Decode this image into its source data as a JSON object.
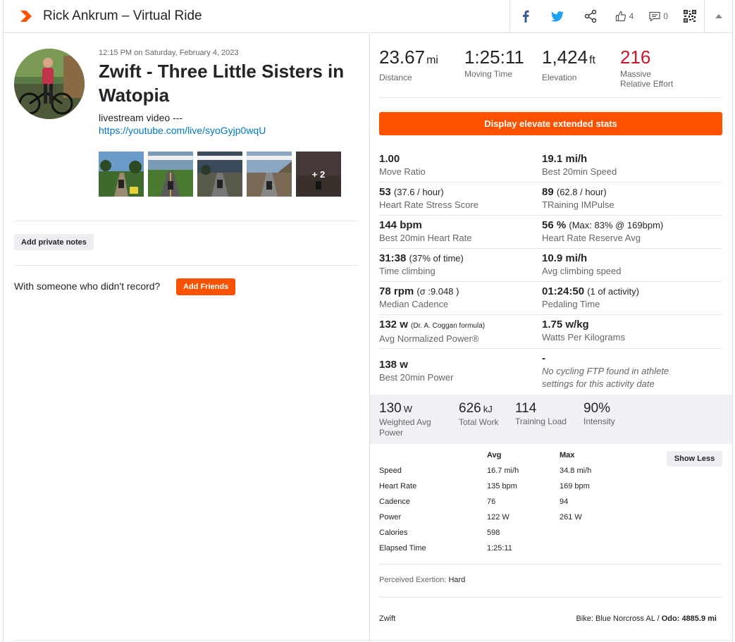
{
  "header": {
    "title": "Rick Ankrum – Virtual Ride",
    "kudos_count": "4",
    "comment_count": "0"
  },
  "activity": {
    "timestamp": "12:15 PM on Saturday, February 4, 2023",
    "title": "Zwift - Three Little Sisters in Watopia",
    "description": "livestream video ---",
    "link": "https://youtube.com/live/syoGyjp0wqU",
    "photos_more": "+ 2"
  },
  "left": {
    "private_notes_label": "Add private notes",
    "with_someone_text": "With someone who didn't record?",
    "add_friends_label": "Add Friends"
  },
  "summary": {
    "distance_value": "23.67",
    "distance_unit": "mi",
    "distance_label": "Distance",
    "moving_time_value": "1:25:11",
    "moving_time_label": "Moving Time",
    "elevation_value": "1,424",
    "elevation_unit": "ft",
    "elevation_label": "Elevation",
    "effort_value": "216",
    "effort_label_1": "Massive",
    "effort_label_2": "Relative Effort"
  },
  "extended_button_label": "Display elevate extended stats",
  "extended": {
    "move_ratio_value": "1.00",
    "move_ratio_label": "Move Ratio",
    "best20speed_value": "19.1 mi/h",
    "best20speed_label": "Best 20min Speed",
    "hrss_value": "53",
    "hrss_sub": "(37.6 / hour)",
    "hrss_label": "Heart Rate Stress Score",
    "trimp_value": "89",
    "trimp_sub": "(62.8 / hour)",
    "trimp_label": "TRaining IMPulse",
    "best20hr_value": "144 bpm",
    "best20hr_label": "Best 20min Heart Rate",
    "hrr_value": "56 %",
    "hrr_sub": "(Max: 83% @ 169bpm)",
    "hrr_label": "Heart Rate Reserve Avg",
    "climb_time_value": "31:38",
    "climb_time_sub": "(37% of time)",
    "climb_time_label": "Time climbing",
    "climb_speed_value": "10.9 mi/h",
    "climb_speed_label": "Avg climbing speed",
    "cadence_value": "78 rpm",
    "cadence_sub": "(σ :9.048 )",
    "cadence_label": "Median Cadence",
    "pedal_time_value": "01:24:50",
    "pedal_time_sub": "(1 of activity)",
    "pedal_time_label": "Pedaling Time",
    "np_value": "132 w",
    "np_sub": "(Dr. A. Coggan formula)",
    "np_label": "Avg Normalized Power®",
    "wkg_value": "1.75 w/kg",
    "wkg_label": "Watts Per Kilograms",
    "best20power_value": "138 w",
    "best20power_label": "Best 20min Power",
    "ftp_value": "-",
    "ftp_note_1": "No cycling FTP found in athlete",
    "ftp_note_2": "settings for this activity date"
  },
  "power_summary": {
    "weighted_value": "130",
    "weighted_unit": "W",
    "weighted_label_1": "Weighted Avg",
    "weighted_label_2": "Power",
    "work_value": "626",
    "work_unit": "kJ",
    "work_label": "Total Work",
    "load_value": "114",
    "load_label": "Training Load",
    "intensity_value": "90%",
    "intensity_label": "Intensity"
  },
  "table": {
    "col_avg": "Avg",
    "col_max": "Max",
    "show_less_label": "Show Less",
    "rows": [
      {
        "label": "Speed",
        "avg": "16.7 mi/h",
        "max": "34.8 mi/h"
      },
      {
        "label": "Heart Rate",
        "avg": "135 bpm",
        "max": "169 bpm"
      },
      {
        "label": "Cadence",
        "avg": "76",
        "max": "94"
      },
      {
        "label": "Power",
        "avg": "122 W",
        "max": "261 W"
      },
      {
        "label": "Calories",
        "avg": "598",
        "max": ""
      },
      {
        "label": "Elapsed Time",
        "avg": "1:25:11",
        "max": ""
      }
    ]
  },
  "footer": {
    "exertion_label": "Perceived Exertion:",
    "exertion_value": "Hard",
    "device": "Zwift",
    "bike_label": "Bike: Blue Norcross AL /",
    "odo_label": "Odo: 4885.9 mi"
  },
  "colors": {
    "brand": "#fc5200",
    "effort_red": "#c7172d",
    "link": "#0079c1"
  }
}
